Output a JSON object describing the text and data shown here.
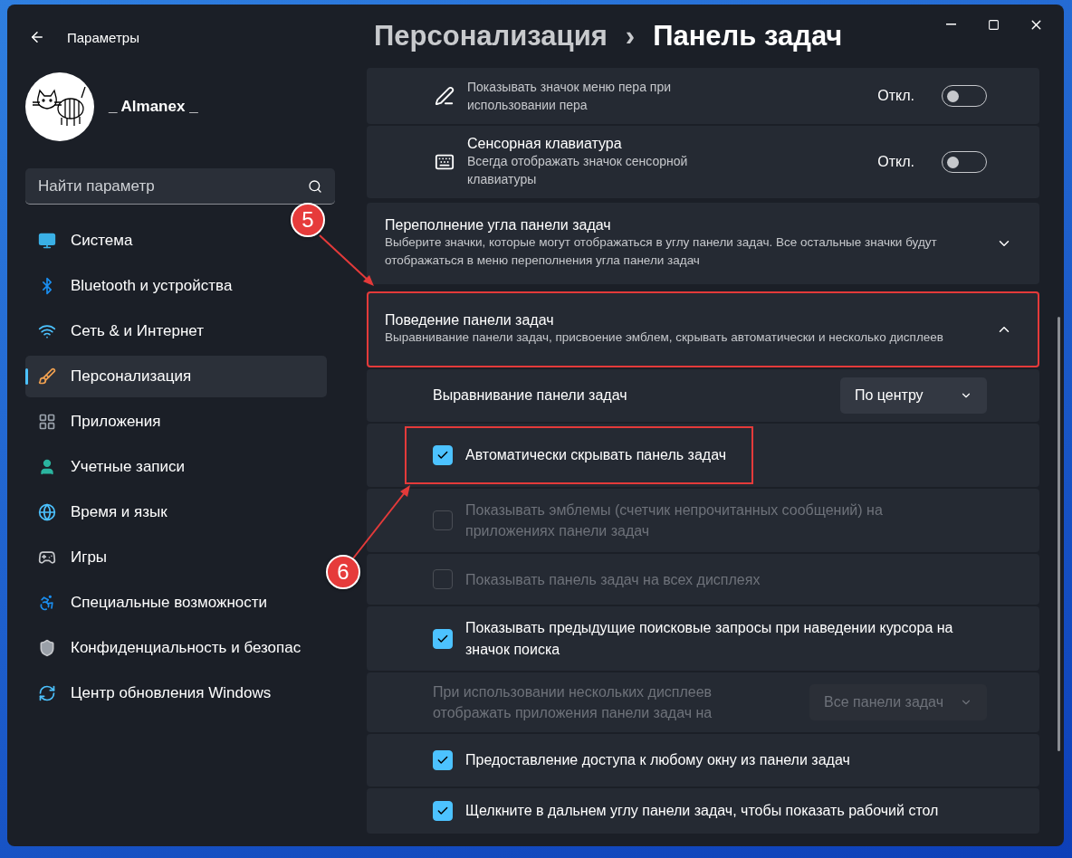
{
  "window": {
    "title": "Параметры"
  },
  "user": {
    "name": "_ Almanex _"
  },
  "search": {
    "placeholder": "Найти параметр"
  },
  "sidebar": {
    "items": [
      {
        "label": "Система",
        "selected": false
      },
      {
        "label": "Bluetooth и устройства",
        "selected": false
      },
      {
        "label": "Сеть & и Интернет",
        "selected": false
      },
      {
        "label": "Персонализация",
        "selected": true
      },
      {
        "label": "Приложения",
        "selected": false
      },
      {
        "label": "Учетные записи",
        "selected": false
      },
      {
        "label": "Время и язык",
        "selected": false
      },
      {
        "label": "Игры",
        "selected": false
      },
      {
        "label": "Специальные возможности",
        "selected": false
      },
      {
        "label": "Конфиденциальность и безопас",
        "selected": false
      },
      {
        "label": "Центр обновления Windows",
        "selected": false
      }
    ]
  },
  "breadcrumb": {
    "parent": "Персонализация",
    "separator": "›",
    "current": "Панель задач"
  },
  "toggles": [
    {
      "description": "Показывать значок меню пера при использовании пера",
      "state": "Откл.",
      "on": false
    },
    {
      "title": "Сенсорная клавиатура",
      "description": "Всегда отображать значок сенсорной клавиатуры",
      "state": "Откл.",
      "on": false
    }
  ],
  "overflow": {
    "title": "Переполнение угла панели задач",
    "description": "Выберите значки, которые могут отображаться в углу панели задач. Все остальные значки будут отображаться в меню переполнения угла панели задач",
    "expanded": false
  },
  "behavior": {
    "title": "Поведение панели задач",
    "description": "Выравнивание панели задач, присвоение эмблем, скрывать автоматически и несколько дисплеев",
    "expanded": true,
    "highlighted": true,
    "settings": [
      {
        "kind": "dropdown",
        "label": "Выравнивание панели задач",
        "value": "По центру",
        "disabled": false
      },
      {
        "kind": "checkbox",
        "label": "Автоматически скрывать панель задач",
        "checked": true,
        "disabled": false,
        "highlighted": true
      },
      {
        "kind": "checkbox",
        "label": "Показывать эмблемы (счетчик непрочитанных сообщений) на приложениях панели задач",
        "checked": false,
        "disabled": true,
        "highlighted": false
      },
      {
        "kind": "checkbox",
        "label": "Показывать панель задач на всех дисплеях",
        "checked": false,
        "disabled": true,
        "highlighted": false
      },
      {
        "kind": "checkbox",
        "label": "Показывать предыдущие поисковые запросы при наведении курсора на значок поиска",
        "checked": true,
        "disabled": false,
        "highlighted": false
      },
      {
        "kind": "dropdown",
        "label": "При использовании нескольких дисплеев отображать приложения панели задач на",
        "value": "Все панели задач",
        "disabled": true
      },
      {
        "kind": "checkbox",
        "label": "Предоставление доступа к любому окну из панели задач",
        "checked": true,
        "disabled": false,
        "highlighted": false
      },
      {
        "kind": "checkbox",
        "label": "Щелкните в дальнем углу панели задач, чтобы показать рабочий стол",
        "checked": true,
        "disabled": false,
        "highlighted": false
      }
    ]
  },
  "annotations": [
    {
      "number": "5"
    },
    {
      "number": "6"
    }
  ]
}
